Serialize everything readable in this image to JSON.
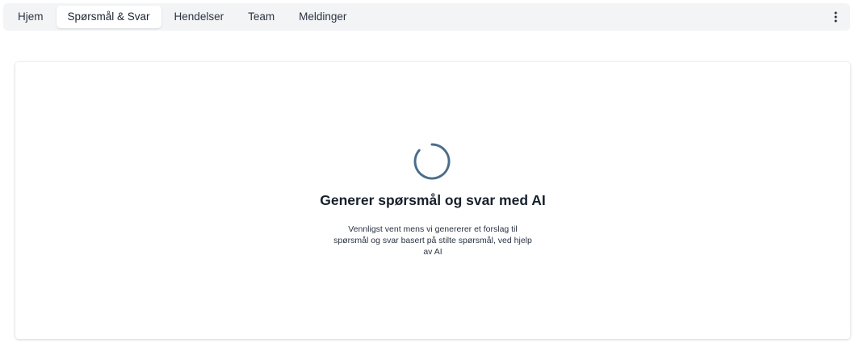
{
  "nav": {
    "tabs": [
      {
        "label": "Hjem"
      },
      {
        "label": "Spørsmål & Svar"
      },
      {
        "label": "Hendelser"
      },
      {
        "label": "Team"
      },
      {
        "label": "Meldinger"
      }
    ],
    "active_tab": "Spørsmål & Svar",
    "more_icon": "kebab-vertical-icon"
  },
  "loading": {
    "icon": "spinner-icon",
    "title": "Generer spørsmål og svar med AI",
    "description": "Vennligst vent mens vi genererer et forslag til spørsmål og svar basert på stilte spørsmål, ved hjelp av AI"
  },
  "colors": {
    "tabbar_bg": "#f3f4f6",
    "spinner": "#4a6d8c",
    "heading": "#17202c"
  }
}
